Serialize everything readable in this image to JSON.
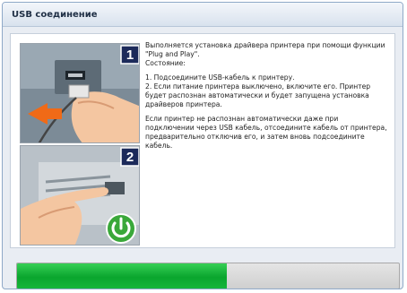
{
  "window": {
    "title": "USB соединение"
  },
  "illustration": {
    "step1_label": "1",
    "step2_label": "2",
    "step1_icons": [
      "usb-port-icon",
      "hand-icon",
      "arrow-icon"
    ],
    "step2_icons": [
      "hand-icon",
      "power-icon"
    ]
  },
  "message": {
    "intro": "Выполняется установка драйвера принтера при помощи функции \"Plug and Play\".",
    "status_label": "Состояние:",
    "step1": "1. Подсоедините USB-кабель к принтеру.",
    "step2": "2. Если питание принтера выключено, включите его. Принтер будет распознан автоматически и будет запущена установка драйверов принтера.",
    "hint": "Если принтер не распознан автоматически даже при подключении через USB кабель, отсоедините кабель от принтера, предварительно отключив его, и затем вновь подсоедините кабель."
  },
  "progress": {
    "value": 0.55
  },
  "colors": {
    "progress_fill": "#0aa52e",
    "step_badge": "#1c2a5a",
    "arrow": "#f06a17",
    "power": "#3aa83a"
  }
}
